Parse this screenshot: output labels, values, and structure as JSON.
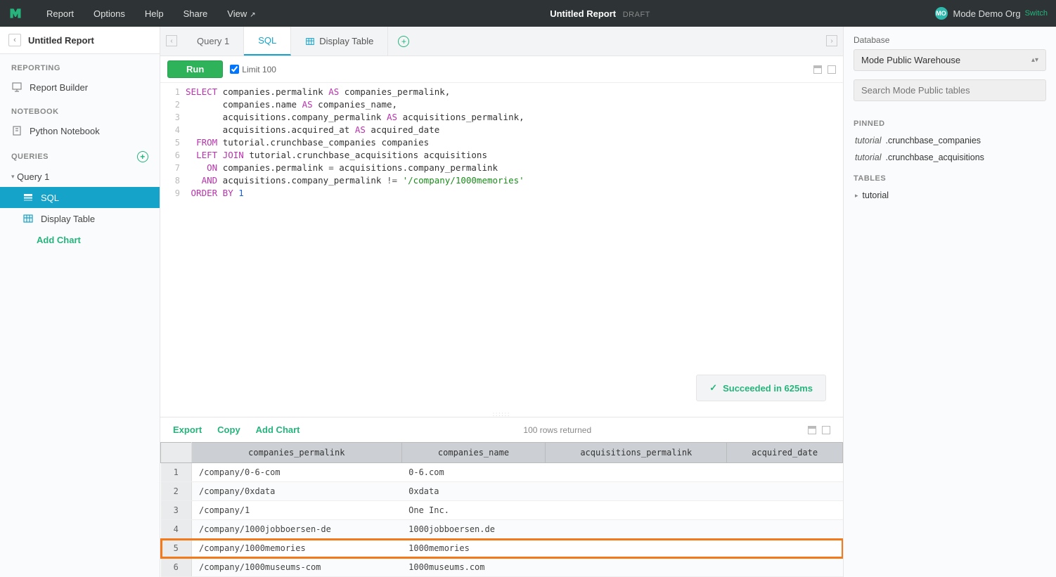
{
  "topnav": {
    "menu": [
      "Report",
      "Options",
      "Help",
      "Share",
      "View"
    ],
    "view_suffix": "↗",
    "title": "Untitled Report",
    "draft": "DRAFT",
    "org_badge": "MO",
    "org_name": "Mode Demo Org",
    "switch": "Switch"
  },
  "sidebar": {
    "back_title": "Untitled Report",
    "sections": {
      "reporting": "REPORTING",
      "notebook": "NOTEBOOK",
      "queries": "QUERIES"
    },
    "report_builder": "Report Builder",
    "python_notebook": "Python Notebook",
    "query1": "Query 1",
    "sql": "SQL",
    "display_table": "Display Table",
    "add_chart": "Add Chart"
  },
  "tabs": {
    "query1": "Query 1",
    "sql": "SQL",
    "display_table": "Display Table"
  },
  "runbar": {
    "run": "Run",
    "limit": "Limit 100"
  },
  "sql": {
    "lines": [
      1,
      2,
      3,
      4,
      5,
      6,
      7,
      8,
      9
    ]
  },
  "status": "Succeeded in 625ms",
  "results": {
    "actions": {
      "export": "Export",
      "copy": "Copy",
      "add_chart": "Add Chart"
    },
    "rows_info": "100 rows returned",
    "columns": [
      "companies_permalink",
      "companies_name",
      "acquisitions_permalink",
      "acquired_date"
    ],
    "rows": [
      {
        "n": 1,
        "c": [
          "/company/0-6-com",
          "0-6.com",
          "",
          ""
        ]
      },
      {
        "n": 2,
        "c": [
          "/company/0xdata",
          "0xdata",
          "",
          ""
        ]
      },
      {
        "n": 3,
        "c": [
          "/company/1",
          "One Inc.",
          "",
          ""
        ]
      },
      {
        "n": 4,
        "c": [
          "/company/1000jobboersen-de",
          "1000jobboersen.de",
          "",
          ""
        ]
      },
      {
        "n": 5,
        "c": [
          "/company/1000memories",
          "1000memories",
          "",
          ""
        ],
        "hl": true
      },
      {
        "n": 6,
        "c": [
          "/company/1000museums-com",
          "1000museums.com",
          "",
          ""
        ]
      }
    ]
  },
  "right": {
    "db_label": "Database",
    "db_value": "Mode Public Warehouse",
    "search_placeholder": "Search Mode Public tables",
    "pinned": "PINNED",
    "pinned_items": [
      {
        "schema": "tutorial",
        "table": "crunchbase_companies"
      },
      {
        "schema": "tutorial",
        "table": "crunchbase_acquisitions"
      }
    ],
    "tables": "TABLES",
    "tables_items": [
      "tutorial"
    ]
  }
}
